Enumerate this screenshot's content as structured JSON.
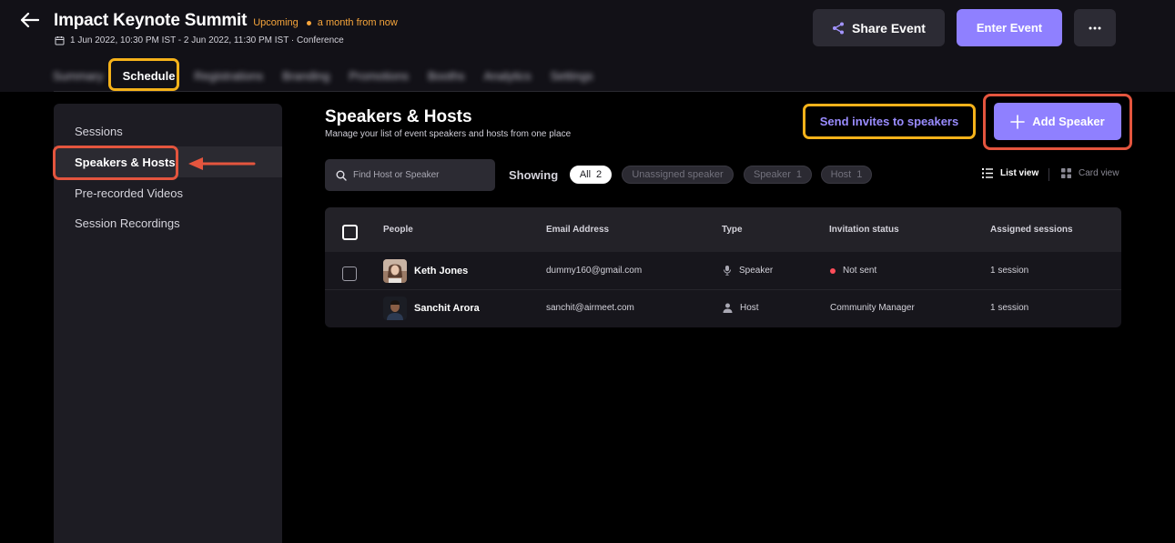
{
  "header": {
    "title": "Impact Keynote Summit",
    "status": "Upcoming",
    "status_relative": "a month from now",
    "date_info": "1 Jun 2022, 10:30 PM IST - 2 Jun 2022, 11:30 PM IST · Conference",
    "share_label": "Share Event",
    "enter_label": "Enter Event"
  },
  "tabs": [
    {
      "label": "Summary"
    },
    {
      "label": "Schedule"
    },
    {
      "label": "Registrations"
    },
    {
      "label": "Branding"
    },
    {
      "label": "Promotions"
    },
    {
      "label": "Booths"
    },
    {
      "label": "Analytics"
    },
    {
      "label": "Settings"
    }
  ],
  "sidebar": {
    "items": [
      {
        "label": "Sessions"
      },
      {
        "label": "Speakers & Hosts"
      },
      {
        "label": "Pre-recorded Videos"
      },
      {
        "label": "Session Recordings"
      }
    ]
  },
  "section": {
    "title": "Speakers & Hosts",
    "subtitle": "Manage your list of event speakers and hosts from one place",
    "invite_label": "Send invites to speakers",
    "add_label": "Add Speaker"
  },
  "filters": {
    "search_placeholder": "Find Host or Speaker",
    "showing_label": "Showing",
    "chips": [
      {
        "label": "All",
        "count": "2"
      },
      {
        "label": "Unassigned speaker",
        "count": ""
      },
      {
        "label": "Speaker",
        "count": "1"
      },
      {
        "label": "Host",
        "count": "1"
      }
    ],
    "list_view": "List view",
    "card_view": "Card view"
  },
  "table": {
    "headers": [
      "People",
      "Email Address",
      "Type",
      "Invitation status",
      "Assigned sessions"
    ],
    "rows": [
      {
        "name": "Keth Jones",
        "email": "dummy160@gmail.com",
        "type": "Speaker",
        "status": "Not sent",
        "sessions": "1 session"
      },
      {
        "name": "Sanchit Arora",
        "email": "sanchit@airmeet.com",
        "type": "Host",
        "status": "Community Manager",
        "sessions": "1 session"
      }
    ]
  },
  "colors": {
    "accent": "#8f80ff",
    "highlight_yellow": "#f5b21a",
    "highlight_red": "#e4553e",
    "status_orange": "#f6a53b"
  }
}
